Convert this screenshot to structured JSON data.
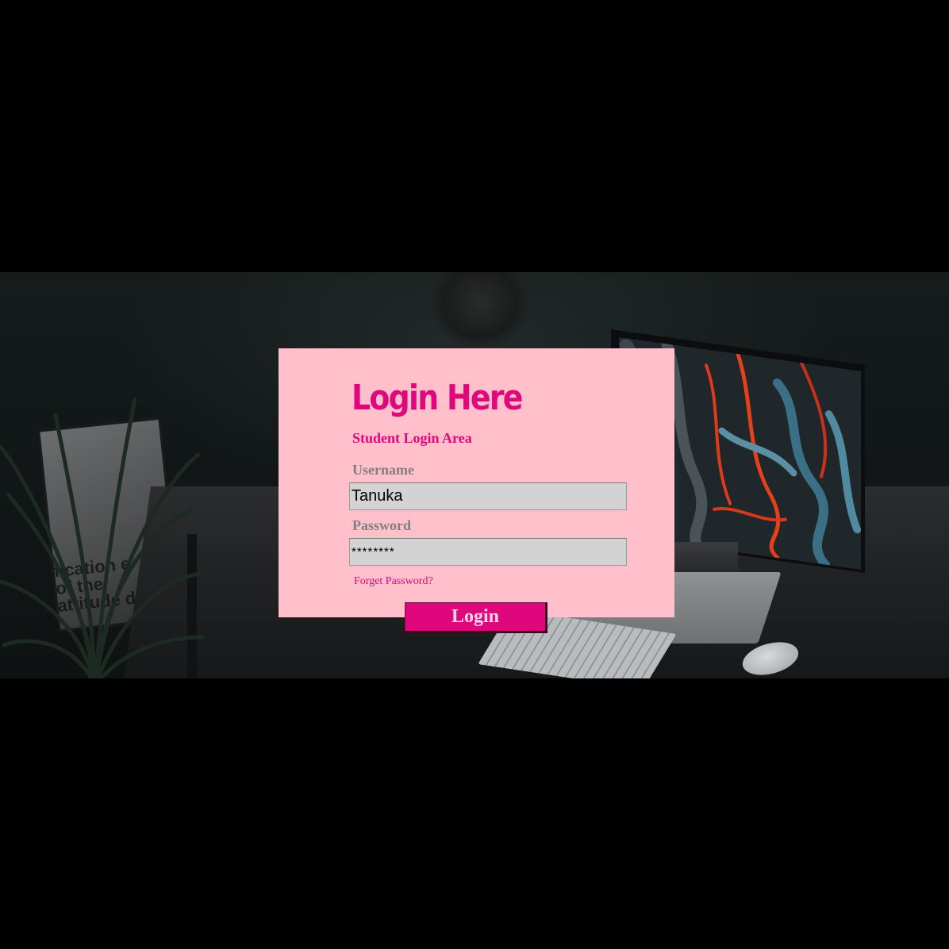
{
  "login": {
    "title": "Login Here",
    "subtitle": "Student Login Area",
    "username_label": "Username",
    "username_value": "Tanuka",
    "password_label": "Password",
    "password_value": "********",
    "forget_password": "Forget Password?",
    "button_label": "Login"
  },
  "background": {
    "poster_text": "fication e of the attitude do"
  },
  "colors": {
    "card_background": "#ffc0cb",
    "accent": "#e0077d",
    "label_gray": "#808080",
    "input_background": "#d3d3d3",
    "page_background": "#000000"
  }
}
